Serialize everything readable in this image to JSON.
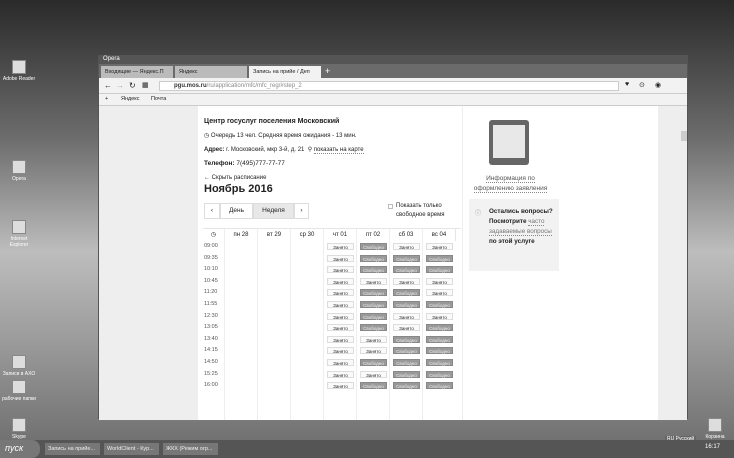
{
  "desktop": {
    "icons": [
      "Корзина",
      "Skype",
      "рабочие папки",
      "Записи в АХО",
      "Internet Explorer",
      "Opera",
      "Adobe Reader"
    ],
    "lang": "RU Русский",
    "clock": "16:17"
  },
  "taskbar": {
    "start": "пуск",
    "tasks": [
      "Запись на прийе...",
      "WorldClient - Кур...",
      "ЖКХ (Режим огр..."
    ]
  },
  "browser": {
    "app": "Opera",
    "tabs": [
      "Входящие — Яндекс.П",
      "Яндекс",
      "Запись на прийе / Деп"
    ],
    "url_host": "pgu.mos.ru",
    "url_path": "/ru/application/mfc/mfc_reg/#step_2",
    "bookmarks": [
      "Яндекс",
      "Почта"
    ]
  },
  "center": {
    "name": "Центр госуслуг поселения Московский",
    "queue": "Очередь 13 чел. Средняя время ожидания - 13 мин.",
    "addr_label": "Адрес:",
    "addr": "г. Московский, мкр 3-й, д. 21",
    "map_link": "показать на карте",
    "phone_label": "Телефон:",
    "phone": "7(495)777-77-77"
  },
  "schedule": {
    "hide": "Скрыть расписание",
    "month": "Ноябрь 2016",
    "prev": "‹",
    "next": "›",
    "day": "День",
    "week": "Неделя",
    "only_free": "Показать только свободное время",
    "days": [
      "пн 28",
      "вт 29",
      "ср 30",
      "чт 01",
      "пт 02",
      "сб 03",
      "вс 04"
    ],
    "busy": "Занято",
    "free": "Свободно",
    "rows": [
      {
        "time": "09:00",
        "s": "ZSZZ"
      },
      {
        "time": "09:35",
        "s": "ZSSS"
      },
      {
        "time": "10:10",
        "s": "ZSSS"
      },
      {
        "time": "10:45",
        "s": "ZZZZ"
      },
      {
        "time": "11:20",
        "s": "ZSSZ"
      },
      {
        "time": "11:55",
        "s": "ZSSS"
      },
      {
        "time": "12:30",
        "s": "ZSZZ"
      },
      {
        "time": "13:05",
        "s": "ZSZS"
      },
      {
        "time": "13:40",
        "s": "ZZSS"
      },
      {
        "time": "14:15",
        "s": "ZZSS"
      },
      {
        "time": "14:50",
        "s": "ZSSS"
      },
      {
        "time": "15:25",
        "s": "ZZSS"
      },
      {
        "time": "16:00",
        "s": "ZSSS"
      }
    ]
  },
  "sidebar": {
    "info_link": "Информация по оформлению заявления",
    "q1": "Остались вопросы? Посмотрите",
    "q_link": "часто задаваемые вопросы",
    "q2": "по этой услуге"
  }
}
